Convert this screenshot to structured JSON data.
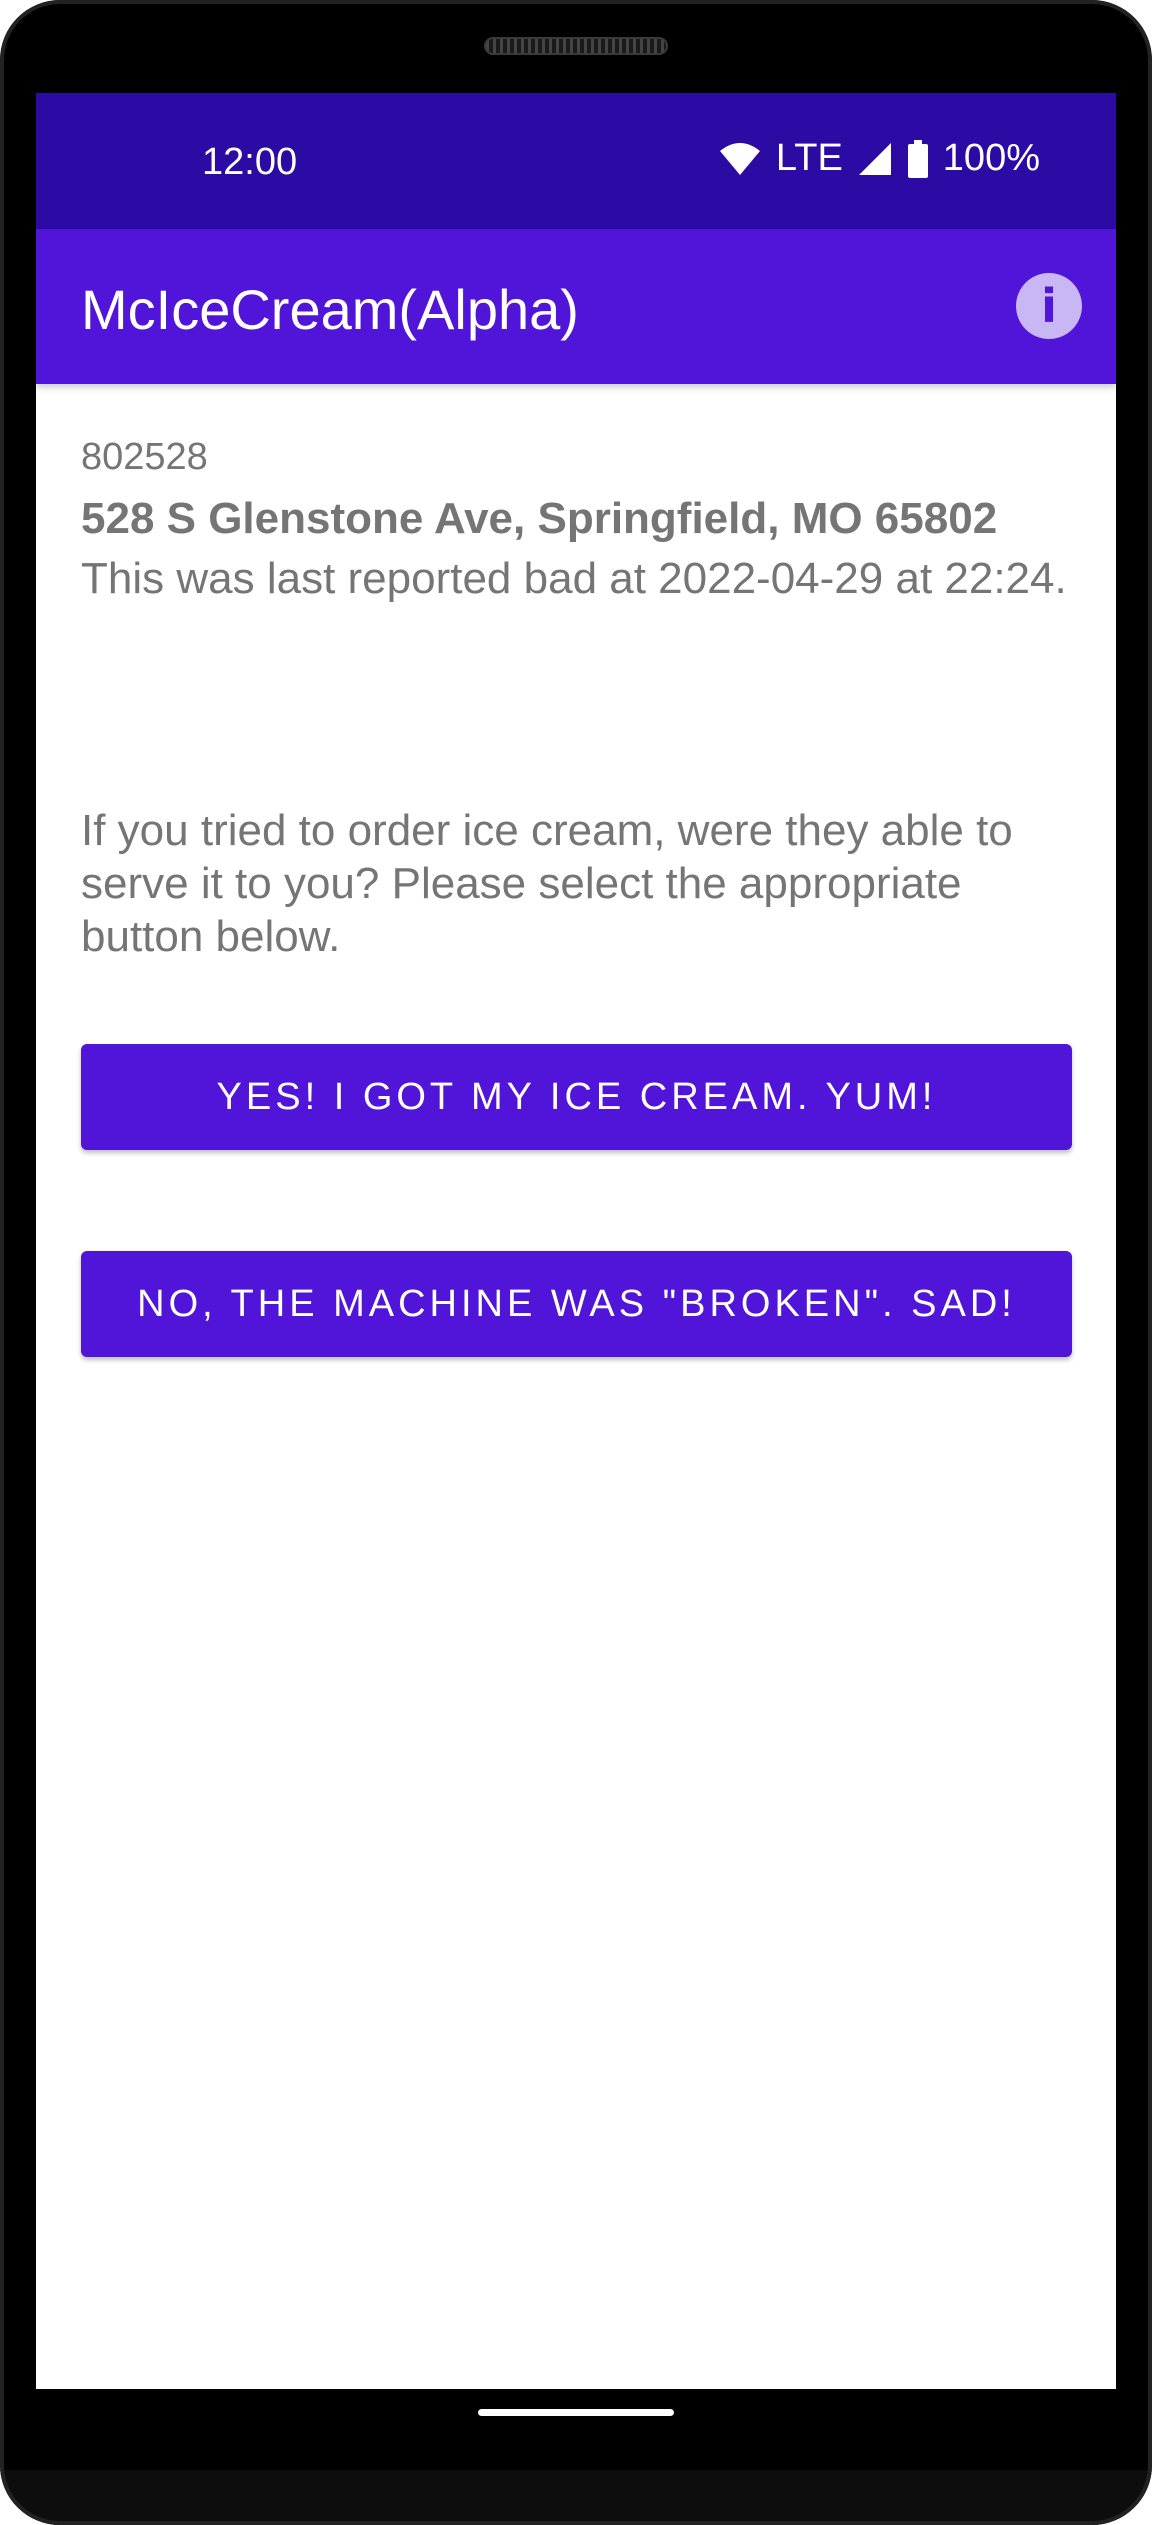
{
  "status_bar": {
    "time": "12:00",
    "network": "LTE",
    "battery": "100%",
    "icons": [
      "wifi-icon",
      "signal-icon",
      "battery-icon"
    ]
  },
  "app_bar": {
    "title": "McIceCream(Alpha)",
    "info_icon_glyph": "i"
  },
  "store": {
    "id": "802528",
    "address": "528 S Glenstone Ave, Springfield, MO 65802",
    "last_reported": "This was last reported bad at 2022-04-29 at 22:24."
  },
  "prompt": {
    "question": "If you tried to order ice cream, were they able to serve it to you? Please select the appropriate button below."
  },
  "buttons": {
    "yes_label": "YES! I GOT MY ICE CREAM. YUM!",
    "no_label": "NO, THE MACHINE WAS \"BROKEN\". SAD!"
  },
  "colors": {
    "status_bar": "#2b0ba3",
    "primary": "#5015d9",
    "info_icon_bg": "#c9b6f5",
    "text_secondary": "#757575"
  }
}
